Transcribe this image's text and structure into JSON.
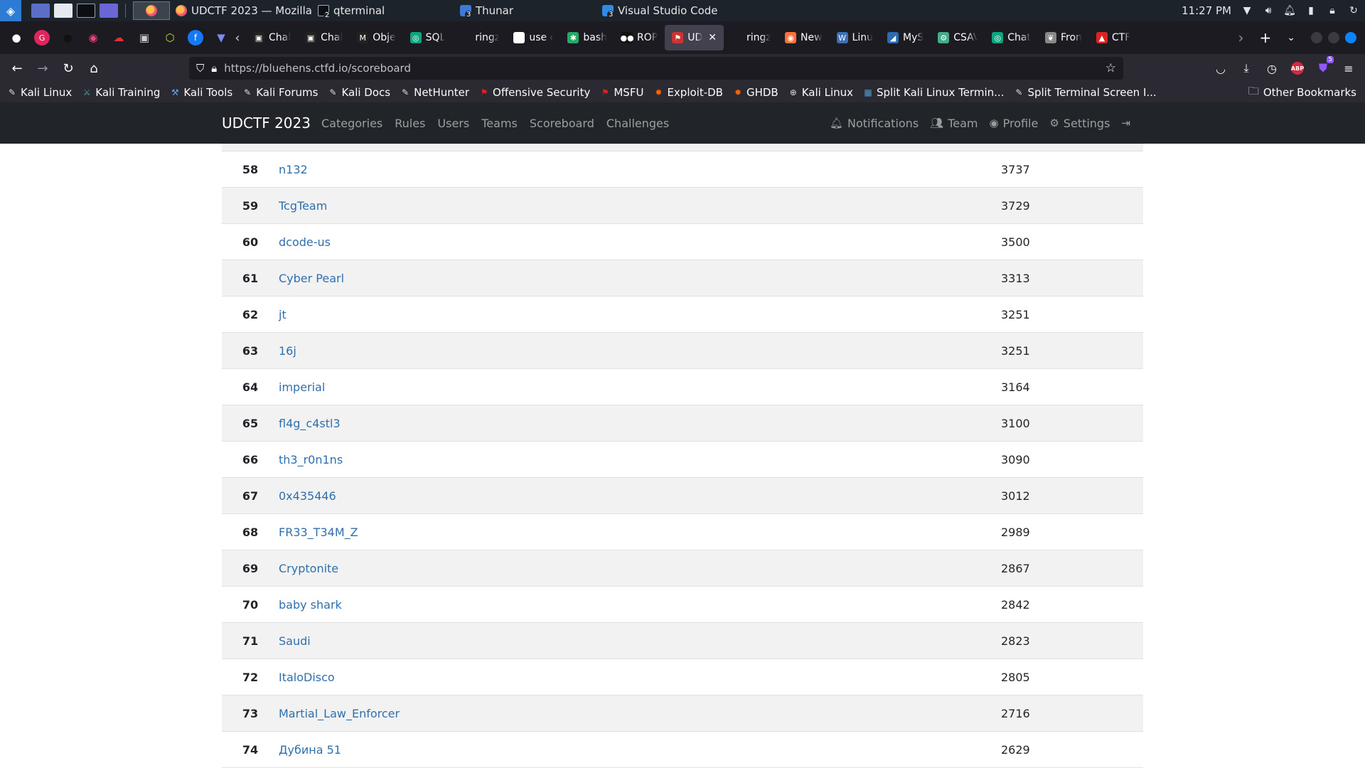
{
  "taskbar": {
    "windows": [
      {
        "title": "UDCTF 2023 — Mozilla ..."
      },
      {
        "title": "qterminal",
        "count": "2"
      },
      {
        "title": "Thunar",
        "count": "3"
      },
      {
        "title": "Visual Studio Code",
        "count": "3"
      }
    ],
    "clock": "11:27 PM"
  },
  "tabs": [
    {
      "label": "Chal",
      "fav": "▣",
      "color": "#222"
    },
    {
      "label": "Chal",
      "fav": "▣",
      "color": "#222"
    },
    {
      "label": "Obje",
      "fav": "M",
      "color": "#222"
    },
    {
      "label": "SQL",
      "fav": "◎",
      "color": "#10a37f"
    },
    {
      "label": "ringzer0",
      "fav": "",
      "color": "transparent"
    },
    {
      "label": "use e",
      "fav": "G",
      "color": "#ffffff"
    },
    {
      "label": "bash",
      "fav": "✱",
      "color": "#2a6"
    },
    {
      "label": "ROP",
      "fav": "●●",
      "color": "#111"
    },
    {
      "label": "UD",
      "fav": "⚑",
      "color": "#c33",
      "selected": true
    },
    {
      "label": "ringzer0",
      "fav": "",
      "color": "transparent"
    },
    {
      "label": "New",
      "fav": "◉",
      "color": "#ff7139"
    },
    {
      "label": "Linu",
      "fav": "W",
      "color": "#3b6fb6"
    },
    {
      "label": "MyS",
      "fav": "◢",
      "color": "#2b6cb0"
    },
    {
      "label": "CSAV",
      "fav": "⚙",
      "color": "#4a8"
    },
    {
      "label": "Chat",
      "fav": "◎",
      "color": "#10a37f"
    },
    {
      "label": "Fron",
      "fav": "❦",
      "color": "#888"
    },
    {
      "label": "CTF",
      "fav": "▲",
      "color": "#d22"
    }
  ],
  "address_bar": {
    "url": "https://bluehens.ctfd.io/scoreboard"
  },
  "bookmarks": [
    {
      "label": "Kali Linux",
      "icon": "dragon-icon"
    },
    {
      "label": "Kali Training",
      "icon": "training-icon"
    },
    {
      "label": "Kali Tools",
      "icon": "tools-icon"
    },
    {
      "label": "Kali Forums",
      "icon": "dragon-icon"
    },
    {
      "label": "Kali Docs",
      "icon": "dragon-icon"
    },
    {
      "label": "NetHunter",
      "icon": "dragon-icon"
    },
    {
      "label": "Offensive Security",
      "icon": "offsec-icon"
    },
    {
      "label": "MSFU",
      "icon": "offsec-icon"
    },
    {
      "label": "Exploit-DB",
      "icon": "exploitdb-icon"
    },
    {
      "label": "GHDB",
      "icon": "exploitdb-icon"
    },
    {
      "label": "Kali Linux",
      "icon": "globe-icon"
    },
    {
      "label": "Split Kali Linux Termin...",
      "icon": "image-icon"
    },
    {
      "label": "Split Terminal Screen I...",
      "icon": "dragon-icon"
    }
  ],
  "other_bookmarks": "Other Bookmarks",
  "ctf_nav": {
    "brand": "UDCTF 2023",
    "links": [
      "Categories",
      "Rules",
      "Users",
      "Teams",
      "Scoreboard",
      "Challenges"
    ],
    "notifications": "Notifications",
    "team": "Team",
    "profile": "Profile",
    "settings": "Settings"
  },
  "scoreboard": [
    {
      "place": "58",
      "team": "n132",
      "score": "3737"
    },
    {
      "place": "59",
      "team": "TcgTeam",
      "score": "3729"
    },
    {
      "place": "60",
      "team": "dcode-us",
      "score": "3500"
    },
    {
      "place": "61",
      "team": "Cyber Pearl",
      "score": "3313"
    },
    {
      "place": "62",
      "team": "jt",
      "score": "3251"
    },
    {
      "place": "63",
      "team": "16j",
      "score": "3251"
    },
    {
      "place": "64",
      "team": "imperial",
      "score": "3164"
    },
    {
      "place": "65",
      "team": "fl4g_c4stl3",
      "score": "3100"
    },
    {
      "place": "66",
      "team": "th3_r0n1ns",
      "score": "3090"
    },
    {
      "place": "67",
      "team": "0x435446",
      "score": "3012"
    },
    {
      "place": "68",
      "team": "FR33_T34M_Z",
      "score": "2989"
    },
    {
      "place": "69",
      "team": "Cryptonite",
      "score": "2867"
    },
    {
      "place": "70",
      "team": "baby shark",
      "score": "2842"
    },
    {
      "place": "71",
      "team": "Saudi",
      "score": "2823"
    },
    {
      "place": "72",
      "team": "ItaloDisco",
      "score": "2805"
    },
    {
      "place": "73",
      "team": "Martial_Law_Enforcer",
      "score": "2716"
    },
    {
      "place": "74",
      "team": "Дубина 51",
      "score": "2629"
    }
  ]
}
